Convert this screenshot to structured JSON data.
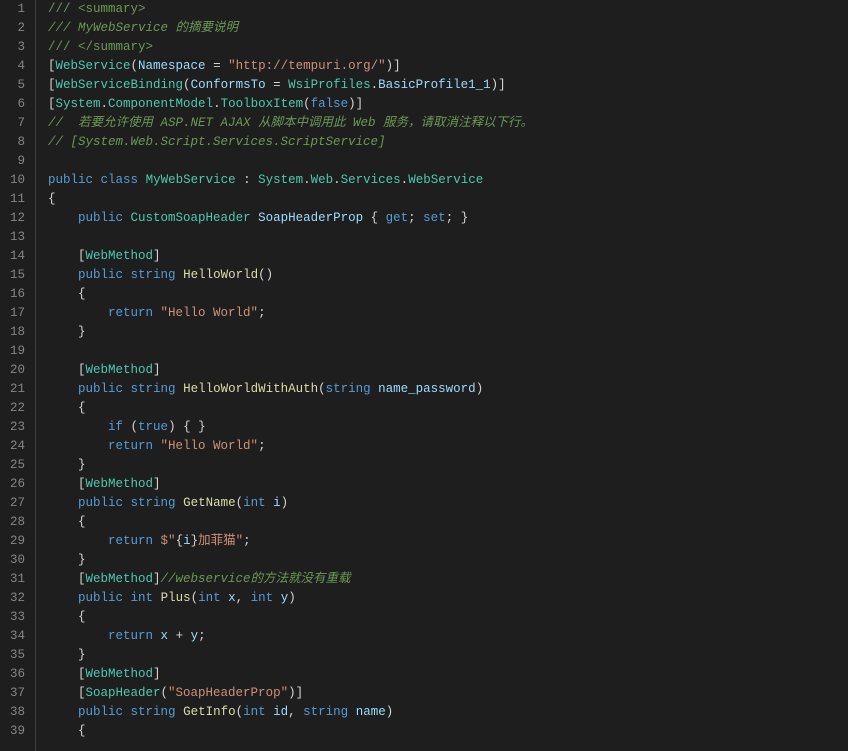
{
  "lines": [
    {
      "n": 1,
      "seg": [
        {
          "t": "/// <summary>",
          "c": "c-comment"
        }
      ]
    },
    {
      "n": 2,
      "seg": [
        {
          "t": "/// MyWebService 的摘要说明",
          "c": "c-comment-it"
        }
      ]
    },
    {
      "n": 3,
      "seg": [
        {
          "t": "/// </summary>",
          "c": "c-comment"
        }
      ]
    },
    {
      "n": 4,
      "seg": [
        {
          "t": "[",
          "c": "c-punc"
        },
        {
          "t": "WebService",
          "c": "c-type"
        },
        {
          "t": "(",
          "c": "c-punc"
        },
        {
          "t": "Namespace",
          "c": "c-var"
        },
        {
          "t": " = ",
          "c": "c-punc"
        },
        {
          "t": "\"http://tempuri.org/\"",
          "c": "c-string"
        },
        {
          "t": ")]",
          "c": "c-punc"
        }
      ]
    },
    {
      "n": 5,
      "seg": [
        {
          "t": "[",
          "c": "c-punc"
        },
        {
          "t": "WebServiceBinding",
          "c": "c-type"
        },
        {
          "t": "(",
          "c": "c-punc"
        },
        {
          "t": "ConformsTo",
          "c": "c-var"
        },
        {
          "t": " = ",
          "c": "c-punc"
        },
        {
          "t": "WsiProfiles",
          "c": "c-type"
        },
        {
          "t": ".",
          "c": "c-punc"
        },
        {
          "t": "BasicProfile1_1",
          "c": "c-var"
        },
        {
          "t": ")]",
          "c": "c-punc"
        }
      ]
    },
    {
      "n": 6,
      "seg": [
        {
          "t": "[",
          "c": "c-punc"
        },
        {
          "t": "System",
          "c": "c-type"
        },
        {
          "t": ".",
          "c": "c-punc"
        },
        {
          "t": "ComponentModel",
          "c": "c-type"
        },
        {
          "t": ".",
          "c": "c-punc"
        },
        {
          "t": "ToolboxItem",
          "c": "c-type"
        },
        {
          "t": "(",
          "c": "c-punc"
        },
        {
          "t": "false",
          "c": "c-keyword"
        },
        {
          "t": ")]",
          "c": "c-punc"
        }
      ]
    },
    {
      "n": 7,
      "seg": [
        {
          "t": "//  若要允许使用 ASP.NET AJAX 从脚本中调用此 Web 服务，请取消注释以下行。",
          "c": "c-comment-it"
        }
      ]
    },
    {
      "n": 8,
      "seg": [
        {
          "t": "// [System.Web.Script.Services.ScriptService]",
          "c": "c-comment-it"
        }
      ]
    },
    {
      "n": 9,
      "seg": []
    },
    {
      "n": 10,
      "seg": [
        {
          "t": "public",
          "c": "c-keyword"
        },
        {
          "t": " ",
          "c": ""
        },
        {
          "t": "class",
          "c": "c-keyword"
        },
        {
          "t": " ",
          "c": ""
        },
        {
          "t": "MyWebService",
          "c": "c-type"
        },
        {
          "t": " : ",
          "c": "c-punc"
        },
        {
          "t": "System",
          "c": "c-type"
        },
        {
          "t": ".",
          "c": "c-punc"
        },
        {
          "t": "Web",
          "c": "c-type"
        },
        {
          "t": ".",
          "c": "c-punc"
        },
        {
          "t": "Services",
          "c": "c-type"
        },
        {
          "t": ".",
          "c": "c-punc"
        },
        {
          "t": "WebService",
          "c": "c-type"
        }
      ]
    },
    {
      "n": 11,
      "seg": [
        {
          "t": "{",
          "c": "c-punc"
        }
      ]
    },
    {
      "n": 12,
      "seg": [
        {
          "t": "    ",
          "c": ""
        },
        {
          "t": "public",
          "c": "c-keyword"
        },
        {
          "t": " ",
          "c": ""
        },
        {
          "t": "CustomSoapHeader",
          "c": "c-type"
        },
        {
          "t": " ",
          "c": ""
        },
        {
          "t": "SoapHeaderProp",
          "c": "c-var"
        },
        {
          "t": " { ",
          "c": "c-punc"
        },
        {
          "t": "get",
          "c": "c-keyword"
        },
        {
          "t": "; ",
          "c": "c-punc"
        },
        {
          "t": "set",
          "c": "c-keyword"
        },
        {
          "t": "; }",
          "c": "c-punc"
        }
      ]
    },
    {
      "n": 13,
      "seg": []
    },
    {
      "n": 14,
      "seg": [
        {
          "t": "    [",
          "c": "c-punc"
        },
        {
          "t": "WebMethod",
          "c": "c-type"
        },
        {
          "t": "]",
          "c": "c-punc"
        }
      ]
    },
    {
      "n": 15,
      "seg": [
        {
          "t": "    ",
          "c": ""
        },
        {
          "t": "public",
          "c": "c-keyword"
        },
        {
          "t": " ",
          "c": ""
        },
        {
          "t": "string",
          "c": "c-keyword"
        },
        {
          "t": " ",
          "c": ""
        },
        {
          "t": "HelloWorld",
          "c": "c-method"
        },
        {
          "t": "()",
          "c": "c-punc"
        }
      ]
    },
    {
      "n": 16,
      "seg": [
        {
          "t": "    {",
          "c": "c-punc"
        }
      ]
    },
    {
      "n": 17,
      "seg": [
        {
          "t": "        ",
          "c": ""
        },
        {
          "t": "return",
          "c": "c-keyword"
        },
        {
          "t": " ",
          "c": ""
        },
        {
          "t": "\"Hello World\"",
          "c": "c-string"
        },
        {
          "t": ";",
          "c": "c-punc"
        }
      ]
    },
    {
      "n": 18,
      "seg": [
        {
          "t": "    }",
          "c": "c-punc"
        }
      ]
    },
    {
      "n": 19,
      "seg": []
    },
    {
      "n": 20,
      "seg": [
        {
          "t": "    [",
          "c": "c-punc"
        },
        {
          "t": "WebMethod",
          "c": "c-type"
        },
        {
          "t": "]",
          "c": "c-punc"
        }
      ]
    },
    {
      "n": 21,
      "seg": [
        {
          "t": "    ",
          "c": ""
        },
        {
          "t": "public",
          "c": "c-keyword"
        },
        {
          "t": " ",
          "c": ""
        },
        {
          "t": "string",
          "c": "c-keyword"
        },
        {
          "t": " ",
          "c": ""
        },
        {
          "t": "HelloWorldWithAuth",
          "c": "c-method"
        },
        {
          "t": "(",
          "c": "c-punc"
        },
        {
          "t": "string",
          "c": "c-keyword"
        },
        {
          "t": " ",
          "c": ""
        },
        {
          "t": "name_password",
          "c": "c-var"
        },
        {
          "t": ")",
          "c": "c-punc"
        }
      ]
    },
    {
      "n": 22,
      "seg": [
        {
          "t": "    {",
          "c": "c-punc"
        }
      ]
    },
    {
      "n": 23,
      "seg": [
        {
          "t": "        ",
          "c": ""
        },
        {
          "t": "if",
          "c": "c-keyword"
        },
        {
          "t": " (",
          "c": "c-punc"
        },
        {
          "t": "true",
          "c": "c-keyword"
        },
        {
          "t": ") { }",
          "c": "c-punc"
        }
      ]
    },
    {
      "n": 24,
      "seg": [
        {
          "t": "        ",
          "c": ""
        },
        {
          "t": "return",
          "c": "c-keyword"
        },
        {
          "t": " ",
          "c": ""
        },
        {
          "t": "\"Hello World\"",
          "c": "c-string"
        },
        {
          "t": ";",
          "c": "c-punc"
        }
      ]
    },
    {
      "n": 25,
      "seg": [
        {
          "t": "    }",
          "c": "c-punc"
        }
      ]
    },
    {
      "n": 26,
      "seg": [
        {
          "t": "    [",
          "c": "c-punc"
        },
        {
          "t": "WebMethod",
          "c": "c-type"
        },
        {
          "t": "]",
          "c": "c-punc"
        }
      ]
    },
    {
      "n": 27,
      "seg": [
        {
          "t": "    ",
          "c": ""
        },
        {
          "t": "public",
          "c": "c-keyword"
        },
        {
          "t": " ",
          "c": ""
        },
        {
          "t": "string",
          "c": "c-keyword"
        },
        {
          "t": " ",
          "c": ""
        },
        {
          "t": "GetName",
          "c": "c-method"
        },
        {
          "t": "(",
          "c": "c-punc"
        },
        {
          "t": "int",
          "c": "c-keyword"
        },
        {
          "t": " ",
          "c": ""
        },
        {
          "t": "i",
          "c": "c-var"
        },
        {
          "t": ")",
          "c": "c-punc"
        }
      ]
    },
    {
      "n": 28,
      "seg": [
        {
          "t": "    {",
          "c": "c-punc"
        }
      ]
    },
    {
      "n": 29,
      "seg": [
        {
          "t": "        ",
          "c": ""
        },
        {
          "t": "return",
          "c": "c-keyword"
        },
        {
          "t": " ",
          "c": ""
        },
        {
          "t": "$\"",
          "c": "c-string"
        },
        {
          "t": "{",
          "c": "c-punc"
        },
        {
          "t": "i",
          "c": "c-var"
        },
        {
          "t": "}",
          "c": "c-punc"
        },
        {
          "t": "加菲猫\"",
          "c": "c-string"
        },
        {
          "t": ";",
          "c": "c-punc"
        }
      ]
    },
    {
      "n": 30,
      "seg": [
        {
          "t": "    }",
          "c": "c-punc"
        }
      ]
    },
    {
      "n": 31,
      "seg": [
        {
          "t": "    [",
          "c": "c-punc"
        },
        {
          "t": "WebMethod",
          "c": "c-type"
        },
        {
          "t": "]",
          "c": "c-punc"
        },
        {
          "t": "//webservice的方法就没有重载",
          "c": "c-comment-it"
        }
      ]
    },
    {
      "n": 32,
      "seg": [
        {
          "t": "    ",
          "c": ""
        },
        {
          "t": "public",
          "c": "c-keyword"
        },
        {
          "t": " ",
          "c": ""
        },
        {
          "t": "int",
          "c": "c-keyword"
        },
        {
          "t": " ",
          "c": ""
        },
        {
          "t": "Plus",
          "c": "c-method"
        },
        {
          "t": "(",
          "c": "c-punc"
        },
        {
          "t": "int",
          "c": "c-keyword"
        },
        {
          "t": " ",
          "c": ""
        },
        {
          "t": "x",
          "c": "c-var"
        },
        {
          "t": ", ",
          "c": "c-punc"
        },
        {
          "t": "int",
          "c": "c-keyword"
        },
        {
          "t": " ",
          "c": ""
        },
        {
          "t": "y",
          "c": "c-var"
        },
        {
          "t": ")",
          "c": "c-punc"
        }
      ]
    },
    {
      "n": 33,
      "seg": [
        {
          "t": "    {",
          "c": "c-punc"
        }
      ]
    },
    {
      "n": 34,
      "seg": [
        {
          "t": "        ",
          "c": ""
        },
        {
          "t": "return",
          "c": "c-keyword"
        },
        {
          "t": " ",
          "c": ""
        },
        {
          "t": "x",
          "c": "c-var"
        },
        {
          "t": " + ",
          "c": "c-punc"
        },
        {
          "t": "y",
          "c": "c-var"
        },
        {
          "t": ";",
          "c": "c-punc"
        }
      ]
    },
    {
      "n": 35,
      "seg": [
        {
          "t": "    }",
          "c": "c-punc"
        }
      ]
    },
    {
      "n": 36,
      "seg": [
        {
          "t": "    [",
          "c": "c-punc"
        },
        {
          "t": "WebMethod",
          "c": "c-type"
        },
        {
          "t": "]",
          "c": "c-punc"
        }
      ]
    },
    {
      "n": 37,
      "seg": [
        {
          "t": "    [",
          "c": "c-punc"
        },
        {
          "t": "SoapHeader",
          "c": "c-type"
        },
        {
          "t": "(",
          "c": "c-punc"
        },
        {
          "t": "\"SoapHeaderProp\"",
          "c": "c-string"
        },
        {
          "t": ")]",
          "c": "c-punc"
        }
      ]
    },
    {
      "n": 38,
      "seg": [
        {
          "t": "    ",
          "c": ""
        },
        {
          "t": "public",
          "c": "c-keyword"
        },
        {
          "t": " ",
          "c": ""
        },
        {
          "t": "string",
          "c": "c-keyword"
        },
        {
          "t": " ",
          "c": ""
        },
        {
          "t": "GetInfo",
          "c": "c-method"
        },
        {
          "t": "(",
          "c": "c-punc"
        },
        {
          "t": "int",
          "c": "c-keyword"
        },
        {
          "t": " ",
          "c": ""
        },
        {
          "t": "id",
          "c": "c-var"
        },
        {
          "t": ", ",
          "c": "c-punc"
        },
        {
          "t": "string",
          "c": "c-keyword"
        },
        {
          "t": " ",
          "c": ""
        },
        {
          "t": "name",
          "c": "c-var"
        },
        {
          "t": ")",
          "c": "c-punc"
        }
      ]
    },
    {
      "n": 39,
      "seg": [
        {
          "t": "    {",
          "c": "c-punc"
        }
      ]
    }
  ]
}
